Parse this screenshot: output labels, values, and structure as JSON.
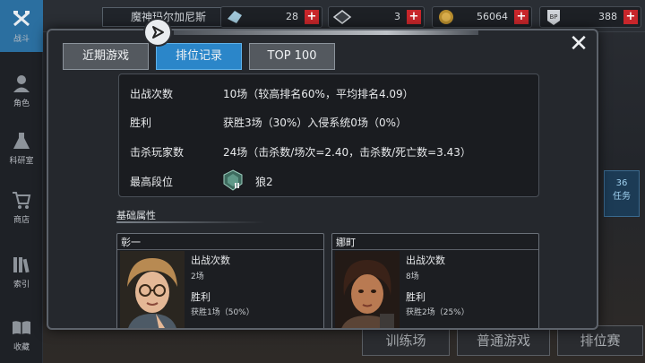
{
  "sidebar": {
    "items": [
      {
        "label": "战斗",
        "icon": "crossed-guns-icon",
        "active": true
      },
      {
        "label": "角色",
        "icon": "character-icon",
        "active": false
      },
      {
        "label": "科研室",
        "icon": "flask-icon",
        "active": false
      },
      {
        "label": "商店",
        "icon": "cart-icon",
        "active": false
      },
      {
        "label": "索引",
        "icon": "books-icon",
        "active": false
      },
      {
        "label": "收藏",
        "icon": "open-book-icon",
        "active": false
      }
    ]
  },
  "topbar": {
    "player_name": "魔神玛尔加尼斯",
    "resources": [
      {
        "icon": "crystal-icon",
        "value": "28"
      },
      {
        "icon": "ticket-icon",
        "value": "3"
      },
      {
        "icon": "coin-icon",
        "value": "56064"
      },
      {
        "icon": "bp-icon",
        "value": "388"
      }
    ]
  },
  "background": {
    "side_panel_text": "36\n任务",
    "bottom_buttons": [
      "训练场",
      "普通游戏",
      "排位赛"
    ]
  },
  "modal": {
    "tabs": [
      {
        "label": "近期游戏",
        "active": false
      },
      {
        "label": "排位记录",
        "active": true
      },
      {
        "label": "TOP 100",
        "active": false
      }
    ],
    "stats": {
      "rows": [
        {
          "key": "出战次数",
          "value": "10场（较高排名60%，平均排名4.09）"
        },
        {
          "key": "胜利",
          "value": "获胜3场（30%）入侵系统0场（0%）"
        },
        {
          "key": "击杀玩家数",
          "value": "24场（击杀数/场次=2.40，击杀数/死亡数=3.43）"
        }
      ],
      "highest_rank_label": "最高段位",
      "highest_rank_value": "狼2",
      "rank_icon": "wolf-rank-icon"
    },
    "section_title": "基础属性",
    "characters": [
      {
        "name": "彰一",
        "stat1_label": "出战次数",
        "stat1_value": "2场",
        "stat2_label": "胜利",
        "stat2_value": "获胜1场（50%）"
      },
      {
        "name": "娜町",
        "stat1_label": "出战次数",
        "stat1_value": "8场",
        "stat2_label": "胜利",
        "stat2_value": "获胜2场（25%）"
      }
    ],
    "colors": {
      "active_tab": "#2b86c9",
      "inactive_tab": "#54595f",
      "panel_bg": "#1a1c20"
    }
  }
}
